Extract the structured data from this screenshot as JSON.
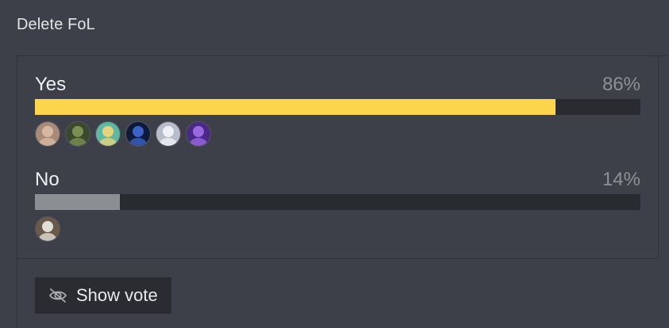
{
  "poll": {
    "title": "Delete FoL",
    "options": [
      {
        "label": "Yes",
        "percent_label": "86%",
        "fraction": 0.86,
        "bar_color": "#fcd54c",
        "voters": [
          {
            "name": "voter-avatar-1",
            "bg": "#a88a7a",
            "fg": "#d6b8a2"
          },
          {
            "name": "voter-avatar-2",
            "bg": "#3b4a2c",
            "fg": "#7a8e56"
          },
          {
            "name": "voter-avatar-3",
            "bg": "#5fb8a4",
            "fg": "#e6d37a"
          },
          {
            "name": "voter-avatar-4",
            "bg": "#0e1a3a",
            "fg": "#3b62c4"
          },
          {
            "name": "voter-avatar-5",
            "bg": "#b9bccb",
            "fg": "#eef0f6"
          },
          {
            "name": "voter-avatar-6",
            "bg": "#4a2a86",
            "fg": "#9a68e0"
          }
        ]
      },
      {
        "label": "No",
        "percent_label": "14%",
        "fraction": 0.14,
        "bar_color": "#8d8e93",
        "voters": [
          {
            "name": "voter-avatar-7",
            "bg": "#6a5a4a",
            "fg": "#e2ddd5"
          }
        ]
      }
    ],
    "show_vote": {
      "label": "Show vote",
      "icon": "eye-slash-icon"
    }
  },
  "colors": {
    "background": "#3e4049",
    "bar_track": "#2a2b30",
    "yes_bar": "#fcd54c",
    "no_bar": "#8d8e93",
    "button_bg": "#2b2c31"
  }
}
